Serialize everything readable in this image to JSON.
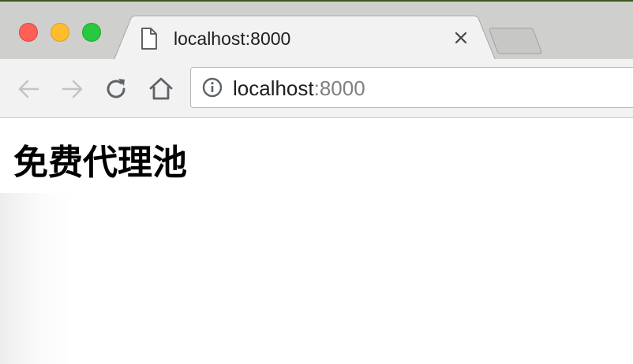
{
  "window": {
    "traffic_lights": {
      "close": "#fe5f57",
      "minimize": "#febc2e",
      "zoom": "#28c840"
    }
  },
  "tab": {
    "title": "localhost:8000",
    "icon": "file-icon",
    "close_icon": "close-icon"
  },
  "toolbar": {
    "back_icon": "arrow-left-icon",
    "forward_icon": "arrow-right-icon",
    "reload_icon": "reload-icon",
    "home_icon": "home-icon"
  },
  "address_bar": {
    "icon": "info-icon",
    "host": "localhost",
    "port": ":8000"
  },
  "page": {
    "heading": "免费代理池"
  }
}
